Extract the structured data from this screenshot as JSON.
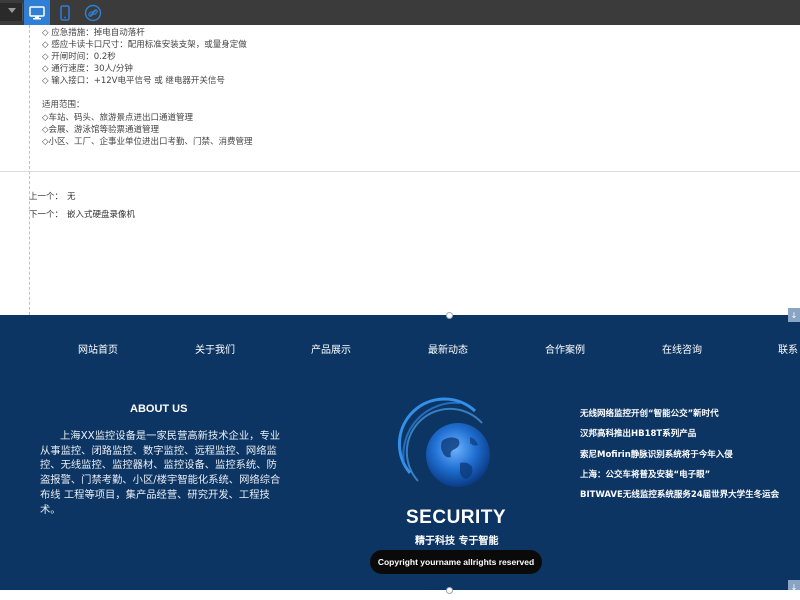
{
  "toolbar": {
    "device_select": "",
    "buttons": [
      {
        "name": "desktop-view",
        "active": true
      },
      {
        "name": "mobile-view",
        "active": false
      },
      {
        "name": "link",
        "active": false
      }
    ]
  },
  "specs": {
    "lines_a": [
      "◇ 应急措施：掉电自动落杆",
      "◇ 感应卡读卡口尺寸：配用标准安装支架，或量身定做",
      "◇ 开闸时间：0.2秒",
      "◇ 通行速度：30人/分钟",
      "◇ 输入接口：+12V电平信号  或 继电器开关信号"
    ],
    "scope_title": "适用范围：",
    "lines_b": [
      "◇车站、码头、旅游景点进出口通道管理",
      "◇会展、游泳馆等验票通道管理",
      "◇小区、工厂、企事业单位进出口考勤、门禁、消费管理"
    ]
  },
  "pager": {
    "prev_label": "上一个：",
    "prev_value": "无",
    "next_label": "下一个：",
    "next_value": "嵌入式硬盘录像机"
  },
  "footer": {
    "menu": [
      "网站首页",
      "关于我们",
      "产品展示",
      "最新动态",
      "合作案例",
      "在线咨询",
      "联系"
    ],
    "about_title": "ABOUT US",
    "about_text": "上海XX监控设备是一家民营高新技术企业，专业 从事监控、闭路监控、数字监控、远程监控、网络监控、无线监控、监控器材、监控设备、监控系统、防盗报警、门禁考勤、小区/楼宇智能化系统、网络综合布线 工程等项目，集产品经营、研究开发、工程技术。",
    "brand": "SECURITY",
    "slogan": "精于科技 专于智能",
    "copyright": "Copyright yourname allrights reserved",
    "news": [
      "无线网络监控开创“智能公交”新时代",
      "汉邦高科推出HB18T系列产品",
      "索尼Mofirin静脉识别系统将于今年入侵",
      "上海：公交车将普及安装“电子眼”",
      "BITWAVE无线监控系统服务24届世界大学生冬运会"
    ]
  },
  "colors": {
    "footer_bg": "#0d3563",
    "toolbar_bg": "#3b3b3b",
    "toolbar_active": "#2f7fd6",
    "copyright_bg": "#0a0a0a"
  }
}
